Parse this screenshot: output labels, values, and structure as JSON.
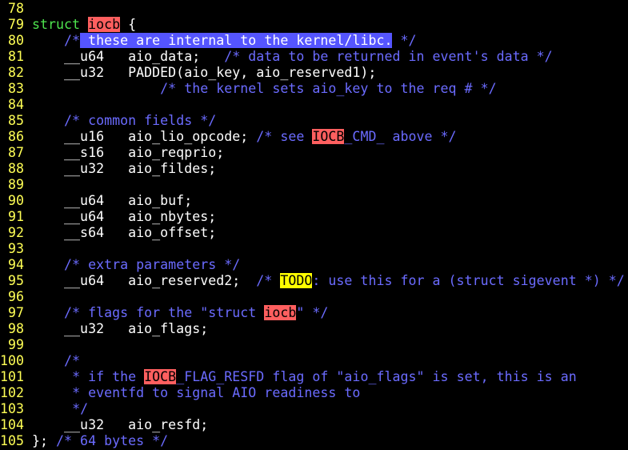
{
  "colors": {
    "background": "#000000",
    "line_number": "#ffff55",
    "keyword": "#4ee44e",
    "comment": "#6b6bff",
    "search_highlight": "#ff5f5f",
    "visual_selection": "#5555ff",
    "todo_highlight": "#ffff00"
  },
  "lines": [
    {
      "n": "78",
      "segs": []
    },
    {
      "n": "79",
      "segs": [
        {
          "t": "struct",
          "c": "kw"
        },
        {
          "t": " "
        },
        {
          "t": "iocb",
          "c": "hl-search"
        },
        {
          "t": " {"
        }
      ]
    },
    {
      "n": "80",
      "segs": [
        {
          "t": "    "
        },
        {
          "t": "/*",
          "c": "cm"
        },
        {
          "t": " these are internal to the kernel/libc.",
          "c": "hl-visual"
        },
        {
          "t": " */",
          "c": "cm"
        }
      ]
    },
    {
      "n": "81",
      "segs": [
        {
          "t": "    __u64   aio_data;   "
        },
        {
          "t": "/* data to be returned in event's data */",
          "c": "cm"
        }
      ]
    },
    {
      "n": "82",
      "segs": [
        {
          "t": "    __u32   PADDED(aio_key, aio_reserved1);"
        }
      ]
    },
    {
      "n": "83",
      "segs": [
        {
          "t": "                "
        },
        {
          "t": "/* the kernel sets aio_key to the req # */",
          "c": "cm"
        }
      ]
    },
    {
      "n": "84",
      "segs": []
    },
    {
      "n": "85",
      "segs": [
        {
          "t": "    "
        },
        {
          "t": "/* common fields */",
          "c": "cm"
        }
      ]
    },
    {
      "n": "86",
      "segs": [
        {
          "t": "    __u16   aio_lio_opcode; "
        },
        {
          "t": "/* see ",
          "c": "cm"
        },
        {
          "t": "IOCB",
          "c": "hl-search"
        },
        {
          "t": "_CMD_ above */",
          "c": "cm"
        }
      ]
    },
    {
      "n": "87",
      "segs": [
        {
          "t": "    __s16   aio_reqprio;"
        }
      ]
    },
    {
      "n": "88",
      "segs": [
        {
          "t": "    __u32   aio_fildes;"
        }
      ]
    },
    {
      "n": "89",
      "segs": []
    },
    {
      "n": "90",
      "segs": [
        {
          "t": "    __u64   aio_buf;"
        }
      ]
    },
    {
      "n": "91",
      "segs": [
        {
          "t": "    __u64   aio_nbytes;"
        }
      ]
    },
    {
      "n": "92",
      "segs": [
        {
          "t": "    __s64   aio_offset;"
        }
      ]
    },
    {
      "n": "93",
      "segs": []
    },
    {
      "n": "94",
      "segs": [
        {
          "t": "    "
        },
        {
          "t": "/* extra parameters */",
          "c": "cm"
        }
      ]
    },
    {
      "n": "95",
      "segs": [
        {
          "t": "    __u64   aio_reserved2;  "
        },
        {
          "t": "/* ",
          "c": "cm"
        },
        {
          "t": "TODO",
          "c": "hl-todo"
        },
        {
          "t": ": use this for a (struct sigevent *) */",
          "c": "cm"
        }
      ]
    },
    {
      "n": "96",
      "segs": []
    },
    {
      "n": "97",
      "segs": [
        {
          "t": "    "
        },
        {
          "t": "/* flags for the \"struct ",
          "c": "cm"
        },
        {
          "t": "iocb",
          "c": "hl-search"
        },
        {
          "t": "\" */",
          "c": "cm"
        }
      ]
    },
    {
      "n": "98",
      "segs": [
        {
          "t": "    __u32   aio_flags;"
        }
      ]
    },
    {
      "n": "99",
      "segs": []
    },
    {
      "n": "100",
      "segs": [
        {
          "t": "    "
        },
        {
          "t": "/*",
          "c": "cm"
        }
      ]
    },
    {
      "n": "101",
      "segs": [
        {
          "t": "     "
        },
        {
          "t": "* if the ",
          "c": "cm"
        },
        {
          "t": "IOCB",
          "c": "hl-search"
        },
        {
          "t": "_FLAG_RESFD flag of \"aio_flags\" is set, this is an",
          "c": "cm"
        }
      ]
    },
    {
      "n": "102",
      "segs": [
        {
          "t": "     "
        },
        {
          "t": "* eventfd to signal AIO readiness to",
          "c": "cm"
        }
      ]
    },
    {
      "n": "103",
      "segs": [
        {
          "t": "     "
        },
        {
          "t": "*/",
          "c": "cm"
        }
      ]
    },
    {
      "n": "104",
      "segs": [
        {
          "t": "    __u32   aio_resfd;"
        }
      ]
    },
    {
      "n": "105",
      "segs": [
        {
          "t": "}; "
        },
        {
          "t": "/* 64 bytes */",
          "c": "cm"
        }
      ]
    }
  ]
}
